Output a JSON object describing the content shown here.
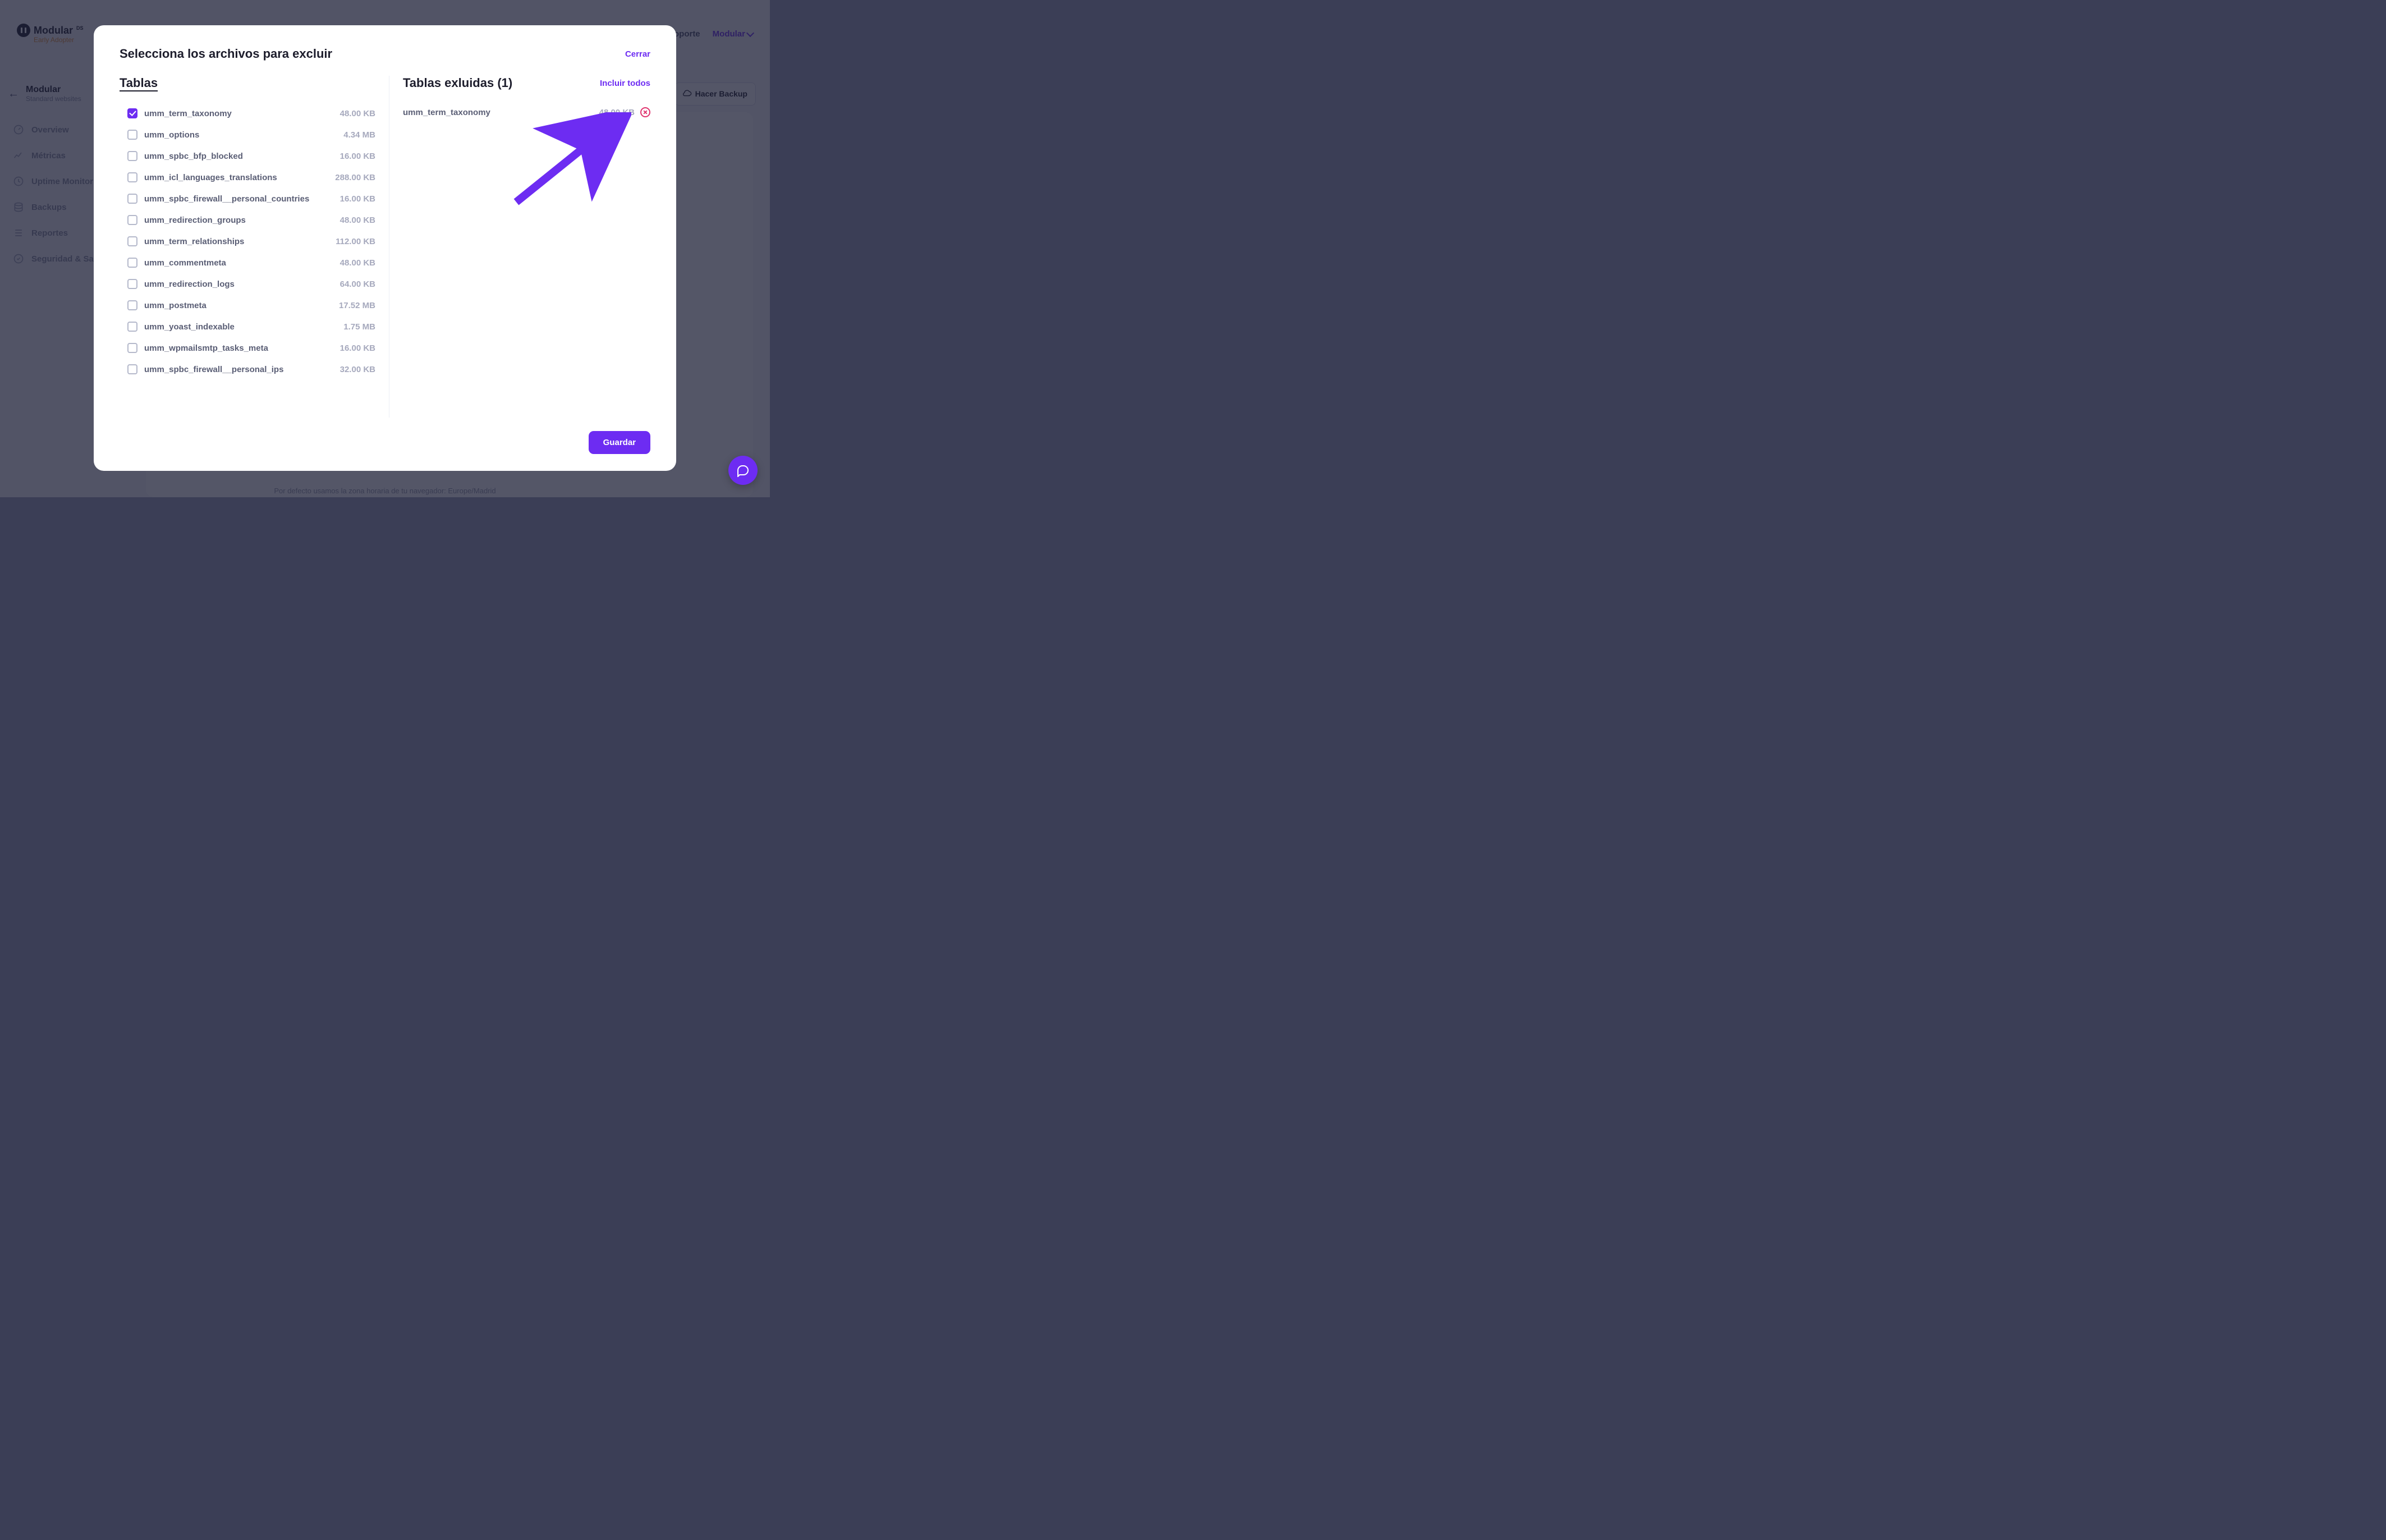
{
  "brand": {
    "name": "Modular",
    "suffix": "DS",
    "subtitle": "Early Adopter"
  },
  "topnav": {
    "support": "Soporte",
    "account": "Modular"
  },
  "header": {
    "site_title": "Modular",
    "site_subtitle": "Standard websites",
    "backup_btn": "Hacer Backup"
  },
  "sidenav": [
    {
      "label": "Overview"
    },
    {
      "label": "Métricas"
    },
    {
      "label": "Uptime Monitor"
    },
    {
      "label": "Backups"
    },
    {
      "label": "Reportes"
    },
    {
      "label": "Seguridad & Salud"
    }
  ],
  "footer_hint": "Por defecto usamos la zona horaria de tu navegador: Europe/Madrid",
  "modal": {
    "title": "Selecciona los archivos para excluir",
    "close": "Cerrar",
    "left_title": "Tablas",
    "right_title": "Tablas exluidas (1)",
    "include_all": "Incluir todos",
    "save": "Guardar",
    "tables": [
      {
        "name": "umm_term_taxonomy",
        "size": "48.00 KB",
        "checked": true
      },
      {
        "name": "umm_options",
        "size": "4.34 MB",
        "checked": false
      },
      {
        "name": "umm_spbc_bfp_blocked",
        "size": "16.00 KB",
        "checked": false
      },
      {
        "name": "umm_icl_languages_translations",
        "size": "288.00 KB",
        "checked": false
      },
      {
        "name": "umm_spbc_firewall__personal_countries",
        "size": "16.00 KB",
        "checked": false
      },
      {
        "name": "umm_redirection_groups",
        "size": "48.00 KB",
        "checked": false
      },
      {
        "name": "umm_term_relationships",
        "size": "112.00 KB",
        "checked": false
      },
      {
        "name": "umm_commentmeta",
        "size": "48.00 KB",
        "checked": false
      },
      {
        "name": "umm_redirection_logs",
        "size": "64.00 KB",
        "checked": false
      },
      {
        "name": "umm_postmeta",
        "size": "17.52 MB",
        "checked": false
      },
      {
        "name": "umm_yoast_indexable",
        "size": "1.75 MB",
        "checked": false
      },
      {
        "name": "umm_wpmailsmtp_tasks_meta",
        "size": "16.00 KB",
        "checked": false
      },
      {
        "name": "umm_spbc_firewall__personal_ips",
        "size": "32.00 KB",
        "checked": false
      }
    ],
    "excluded": [
      {
        "name": "umm_term_taxonomy",
        "size": "48.00 KB"
      }
    ]
  }
}
